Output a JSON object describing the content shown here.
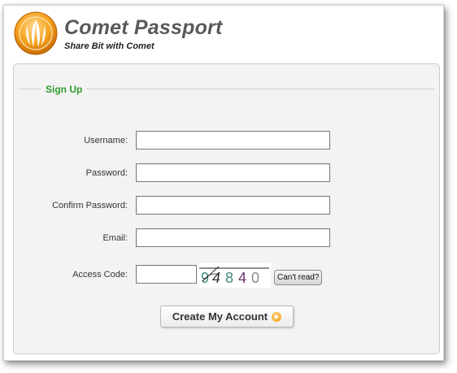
{
  "app": {
    "title": "Comet Passport",
    "subtitle": "Share Bit with Comet",
    "logo_icon": "comet-flame-logo"
  },
  "form": {
    "section_title": "Sign Up",
    "fields": {
      "username": {
        "label": "Username:",
        "value": ""
      },
      "password": {
        "label": "Password:",
        "value": ""
      },
      "confirm_password": {
        "label": "Confirm Password:",
        "value": ""
      },
      "email": {
        "label": "Email:",
        "value": ""
      },
      "access_code": {
        "label": "Access Code:",
        "value": ""
      }
    },
    "captcha": {
      "digits": [
        "9",
        "4",
        "8",
        "4",
        "0"
      ],
      "colors": [
        "#3f8a7a",
        "#333333",
        "#3f8a7a",
        "#6b2f6b",
        "#8a8a8a"
      ]
    },
    "cant_read_label": "Can't read?",
    "submit_label": "Create My Account",
    "submit_icon": "orange-arrow-icon"
  },
  "colors": {
    "legend": "#2f9a2f",
    "title": "#5a5a5a",
    "accent_orange": "#f39a0e"
  }
}
